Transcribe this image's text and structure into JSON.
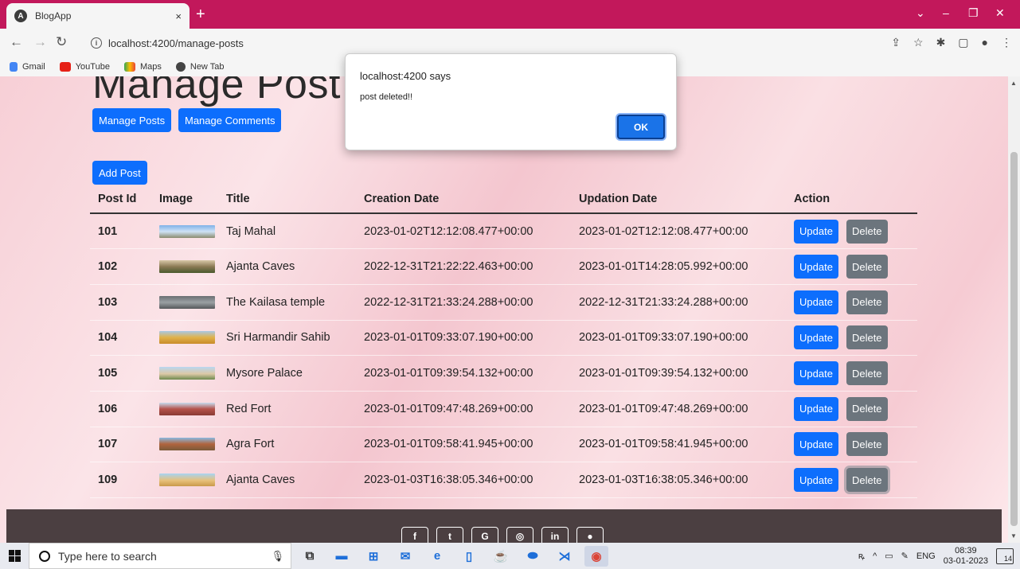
{
  "browser": {
    "tab_title": "BlogApp",
    "tab_close": "×",
    "new_tab": "+",
    "url": "localhost:4200/manage-posts",
    "bookmarks": [
      "Gmail",
      "YouTube",
      "Maps",
      "New Tab"
    ]
  },
  "page": {
    "heading": "Manage Post",
    "nav_buttons": {
      "manage_posts": "Manage Posts",
      "manage_comments": "Manage Comments"
    },
    "add_post": "Add Post",
    "table": {
      "headers": [
        "Post Id",
        "Image",
        "Title",
        "Creation Date",
        "Updation Date",
        "Action"
      ],
      "update_label": "Update",
      "delete_label": "Delete",
      "rows": [
        {
          "id": "101",
          "title": "Taj Mahal",
          "created": "2023-01-02T12:12:08.477+00:00",
          "updated": "2023-01-02T12:12:08.477+00:00"
        },
        {
          "id": "102",
          "title": "Ajanta Caves",
          "created": "2022-12-31T21:22:22.463+00:00",
          "updated": "2023-01-01T14:28:05.992+00:00"
        },
        {
          "id": "103",
          "title": "The Kailasa temple",
          "created": "2022-12-31T21:33:24.288+00:00",
          "updated": "2022-12-31T21:33:24.288+00:00"
        },
        {
          "id": "104",
          "title": "Sri Harmandir Sahib",
          "created": "2023-01-01T09:33:07.190+00:00",
          "updated": "2023-01-01T09:33:07.190+00:00"
        },
        {
          "id": "105",
          "title": "Mysore Palace",
          "created": "2023-01-01T09:39:54.132+00:00",
          "updated": "2023-01-01T09:39:54.132+00:00"
        },
        {
          "id": "106",
          "title": "Red Fort",
          "created": "2023-01-01T09:47:48.269+00:00",
          "updated": "2023-01-01T09:47:48.269+00:00"
        },
        {
          "id": "107",
          "title": "Agra Fort",
          "created": "2023-01-01T09:58:41.945+00:00",
          "updated": "2023-01-01T09:58:41.945+00:00"
        },
        {
          "id": "109",
          "title": "Ajanta Caves",
          "created": "2023-01-03T16:38:05.346+00:00",
          "updated": "2023-01-03T16:38:05.346+00:00"
        }
      ]
    }
  },
  "dialog": {
    "title": "localhost:4200 says",
    "message": "post deleted!!",
    "ok_label": "OK"
  },
  "taskbar": {
    "search_placeholder": "Type here to search",
    "language": "ENG",
    "time": "08:39",
    "date": "03-01-2023",
    "notification_count": "14"
  },
  "colors": {
    "tabbar": "#c2185b",
    "primary_button": "#0d6efd",
    "secondary_button": "#6c757d",
    "footer": "#4b3f41"
  }
}
